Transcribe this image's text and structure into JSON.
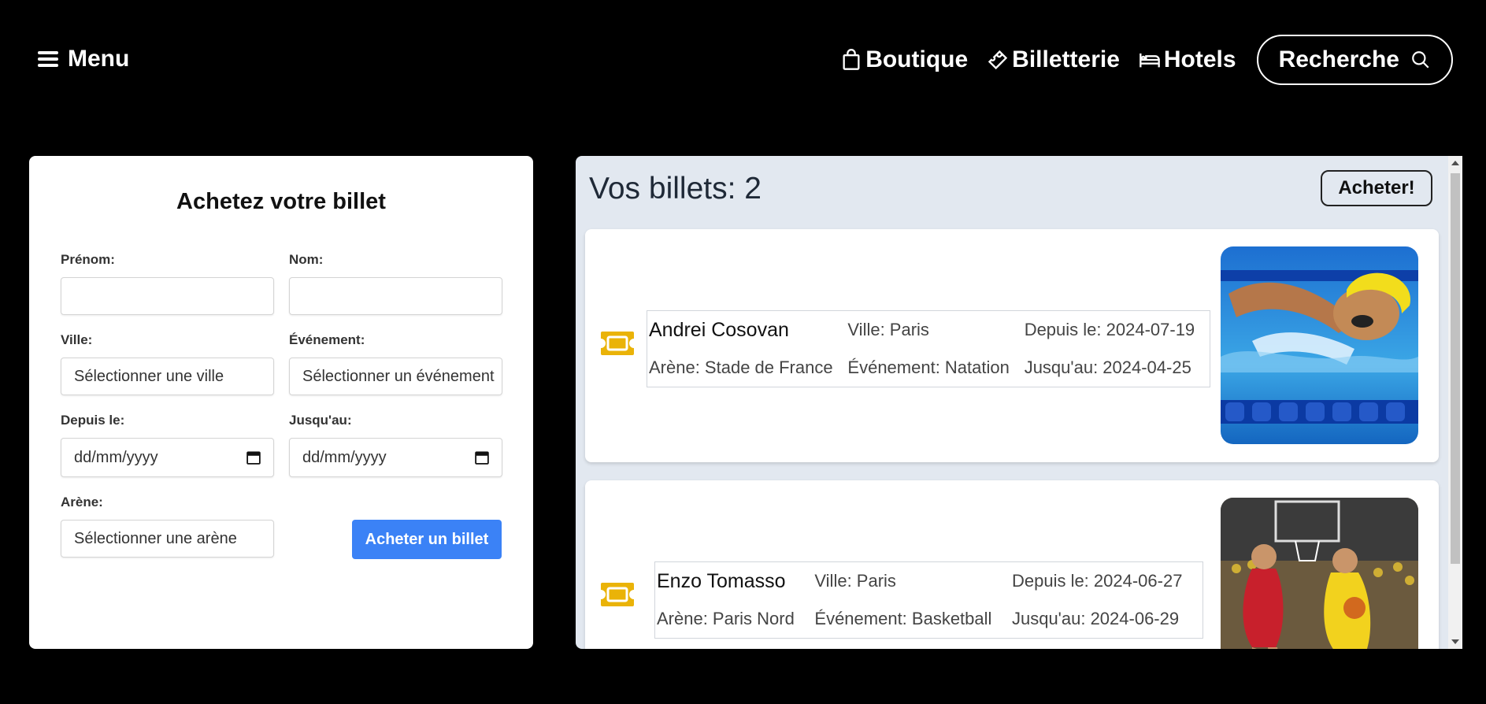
{
  "nav": {
    "menu_label": "Menu",
    "links": [
      {
        "label": "Boutique",
        "icon": "shopping-bag-icon"
      },
      {
        "label": "Billetterie",
        "icon": "ticket-icon"
      },
      {
        "label": "Hotels",
        "icon": "bed-icon"
      }
    ],
    "search_label": "Recherche"
  },
  "form": {
    "title": "Achetez votre billet",
    "prenom_label": "Prénom:",
    "nom_label": "Nom:",
    "ville_label": "Ville:",
    "ville_placeholder": "Sélectionner une ville",
    "evenement_label": "Événement:",
    "evenement_placeholder": "Sélectionner un événement",
    "depuis_label": "Depuis le:",
    "depuis_placeholder": "dd/mm/yyyy",
    "jusqu_label": "Jusqu'au:",
    "jusqu_placeholder": "dd/mm/yyyy",
    "arene_label": "Arène:",
    "arene_placeholder": "Sélectionner une arène",
    "submit_label": "Acheter un billet"
  },
  "tickets": {
    "title": "Vos billets: 2",
    "buy_label": "Acheter!",
    "items": [
      {
        "name": "Andrei Cosovan",
        "ville": "Ville: Paris",
        "depuis": "Depuis le: 2024-07-19",
        "arene": "Arène: Stade de France",
        "evenement": "Événement: Natation",
        "jusqu": "Jusqu'au: 2024-04-25",
        "image": "swimmer-photo"
      },
      {
        "name": "Enzo Tomasso",
        "ville": "Ville: Paris",
        "depuis": "Depuis le: 2024-06-27",
        "arene": "Arène: Paris Nord",
        "evenement": "Événement: Basketball",
        "jusqu": "Jusqu'au: 2024-06-29",
        "image": "basketball-photo"
      }
    ]
  },
  "colors": {
    "accent": "#3b82f6",
    "ticket_icon": "#eab308",
    "panel_bg": "#e2e8f0"
  }
}
